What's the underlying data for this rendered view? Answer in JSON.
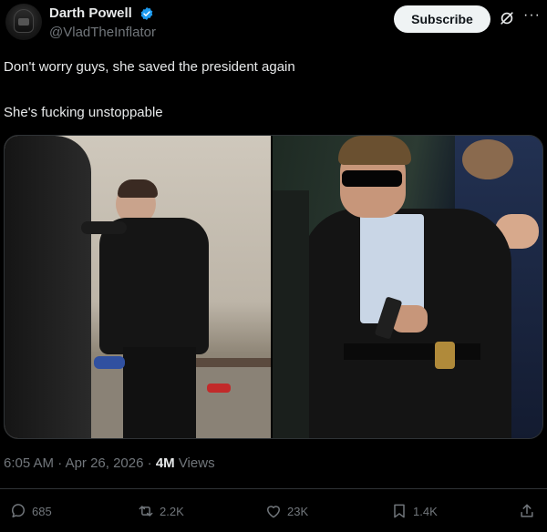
{
  "author": {
    "display_name": "Darth Powell",
    "handle": "@VladTheInflator",
    "verified_icon": "verified-badge-icon",
    "badge_color": "#1d9bf0"
  },
  "header": {
    "subscribe_label": "Subscribe",
    "grok_icon": "grok-icon",
    "more_icon": "more-icon"
  },
  "tweet": {
    "line1": "Don't worry guys, she saved the president again",
    "line2": "She's fucking unstoppable"
  },
  "meta": {
    "time": "6:05 AM",
    "dot1": " · ",
    "date": "Apr 26, 2026",
    "dot2": " · ",
    "views_count": "4M",
    "views_label": " Views"
  },
  "actions": {
    "replies": "685",
    "reposts": "2.2K",
    "likes": "23K",
    "bookmarks": "1.4K"
  },
  "colors": {
    "background": "#000000",
    "text_primary": "#e7e9ea",
    "text_secondary": "#71767b",
    "border": "#2f3336"
  }
}
